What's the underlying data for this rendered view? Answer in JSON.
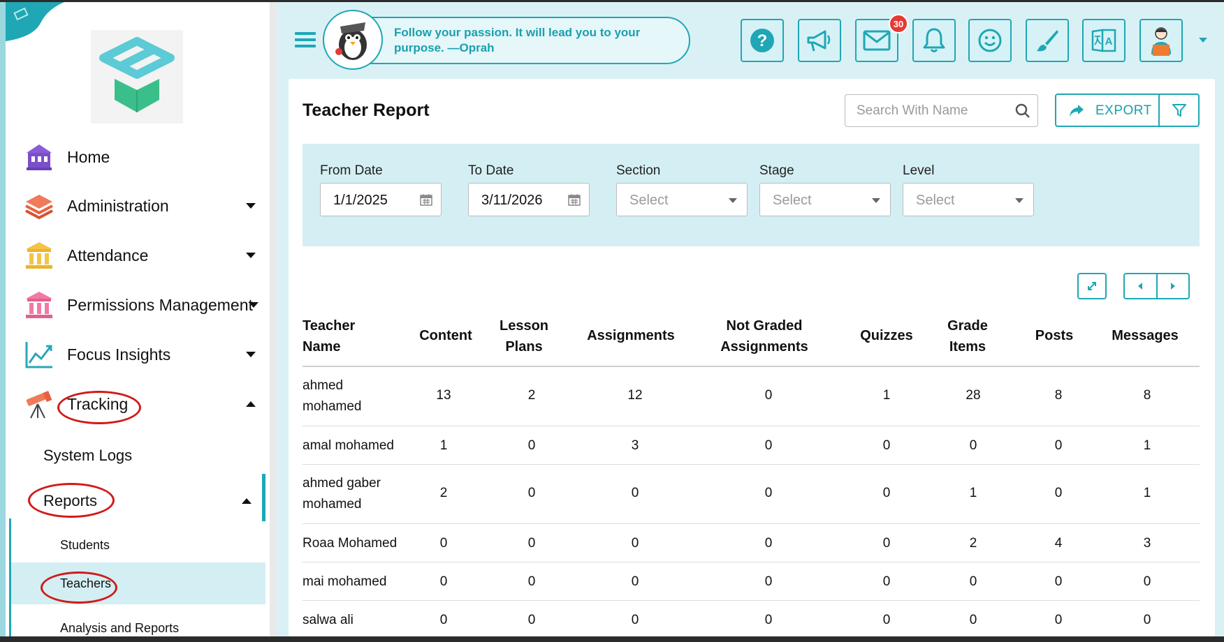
{
  "header": {
    "quote": "Follow your passion. It will lead you to your purpose. —Oprah",
    "mail_badge": "30",
    "accent_color": "#1fa7b5",
    "buttons": [
      "help-icon",
      "megaphone-icon",
      "mail-icon",
      "bell-icon",
      "smiley-icon",
      "brush-icon",
      "translate-icon",
      "profile-icon"
    ]
  },
  "sidebar": {
    "items": [
      {
        "label": "Home",
        "icon": "home-icon"
      },
      {
        "label": "Administration",
        "icon": "layers-icon"
      },
      {
        "label": "Attendance",
        "icon": "building-icon"
      },
      {
        "label": "Permissions Management",
        "icon": "building-pink-icon"
      },
      {
        "label": "Focus Insights",
        "icon": "chart-line-icon"
      },
      {
        "label": "Tracking",
        "icon": "telescope-icon"
      }
    ],
    "sub_items": {
      "system_logs": "System Logs",
      "reports": "Reports",
      "students": "Students",
      "teachers": "Teachers",
      "analysis": "Analysis and Reports"
    }
  },
  "page": {
    "title": "Teacher Report",
    "search_placeholder": "Search With Name",
    "export_label": "EXPORT"
  },
  "filters": {
    "from_label": "From Date",
    "from_value": "1/1/2025",
    "to_label": "To Date",
    "to_value": "3/11/2026",
    "section_label": "Section",
    "section_value": "Select",
    "stage_label": "Stage",
    "stage_value": "Select",
    "level_label": "Level",
    "level_value": "Select"
  },
  "table": {
    "headers": [
      "Teacher Name",
      "Content",
      "Lesson Plans",
      "Assignments",
      "Not Graded Assignments",
      "Quizzes",
      "Grade Items",
      "Posts",
      "Messages"
    ],
    "rows": [
      {
        "name": "ahmed mohamed",
        "values": [
          "13",
          "2",
          "12",
          "0",
          "1",
          "28",
          "8",
          "8"
        ]
      },
      {
        "name": "amal mohamed",
        "values": [
          "1",
          "0",
          "3",
          "0",
          "0",
          "0",
          "0",
          "1"
        ]
      },
      {
        "name": "ahmed gaber mohamed",
        "values": [
          "2",
          "0",
          "0",
          "0",
          "0",
          "1",
          "0",
          "1"
        ]
      },
      {
        "name": "Roaa Mohamed",
        "values": [
          "0",
          "0",
          "0",
          "0",
          "0",
          "2",
          "4",
          "3"
        ]
      },
      {
        "name": "mai mohamed",
        "values": [
          "0",
          "0",
          "0",
          "0",
          "0",
          "0",
          "0",
          "0"
        ]
      },
      {
        "name": "salwa ali",
        "values": [
          "0",
          "0",
          "0",
          "0",
          "0",
          "0",
          "0",
          "0"
        ]
      }
    ]
  }
}
